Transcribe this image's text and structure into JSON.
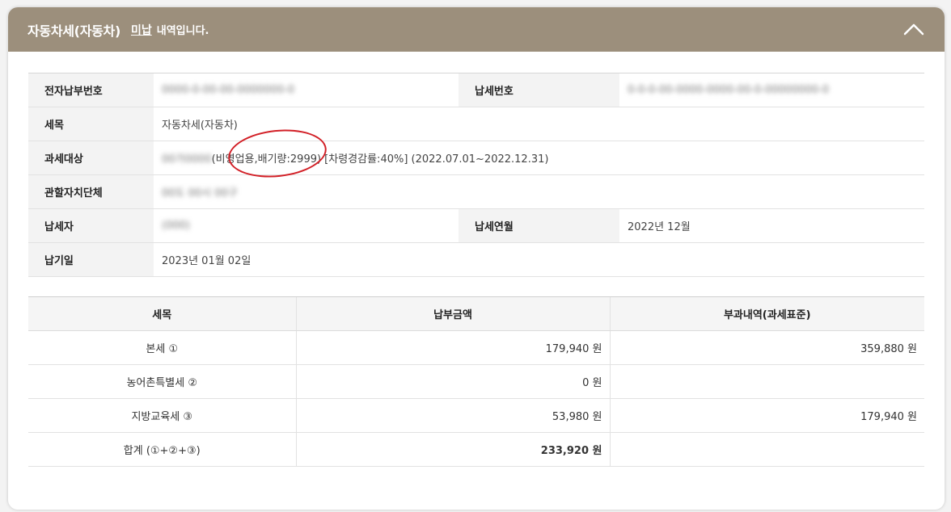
{
  "header": {
    "title": "자동차세(자동차)",
    "status": "미납",
    "suffix": "내역입니다.",
    "toggle_icon": "chevron-up-icon"
  },
  "info": {
    "electronic_payment_no_label": "전자납부번호",
    "electronic_payment_no_value": "0000-0-00-00-0000000-0",
    "tax_no_label": "납세번호",
    "tax_no_value": "0-0-0-00-0000-0000-00-0-00000000-0",
    "tax_item_label": "세목",
    "tax_item_value": "자동차세(자동차)",
    "tax_object_label": "과세대상",
    "tax_object_masked": "00가0000",
    "tax_object_value": "(비영업용,배기량:2999) [차령경감률:40%]  (2022.07.01~2022.12.31)",
    "authority_label": "관할자치단체",
    "authority_value": "00도 00시 00구",
    "taxpayer_label": "납세자",
    "taxpayer_value": "(000)",
    "tax_month_label": "납세연월",
    "tax_month_value": "2022년 12월",
    "due_date_label": "납기일",
    "due_date_value": "2023년 01월 02일"
  },
  "amounts": {
    "headers": [
      "세목",
      "납부금액",
      "부과내역(과세표준)"
    ],
    "rows": [
      {
        "item": "본세 ①",
        "amount": "179,940 원",
        "base": "359,880 원"
      },
      {
        "item": "농어촌특별세 ②",
        "amount": "0 원",
        "base": ""
      },
      {
        "item": "지방교육세 ③",
        "amount": "53,980 원",
        "base": "179,940 원"
      },
      {
        "item": "합계 (①+②+③)",
        "amount": "233,920 원",
        "base": ""
      }
    ]
  },
  "colors": {
    "header_bg": "#9c8f7c",
    "annotation": "#d21f26"
  }
}
